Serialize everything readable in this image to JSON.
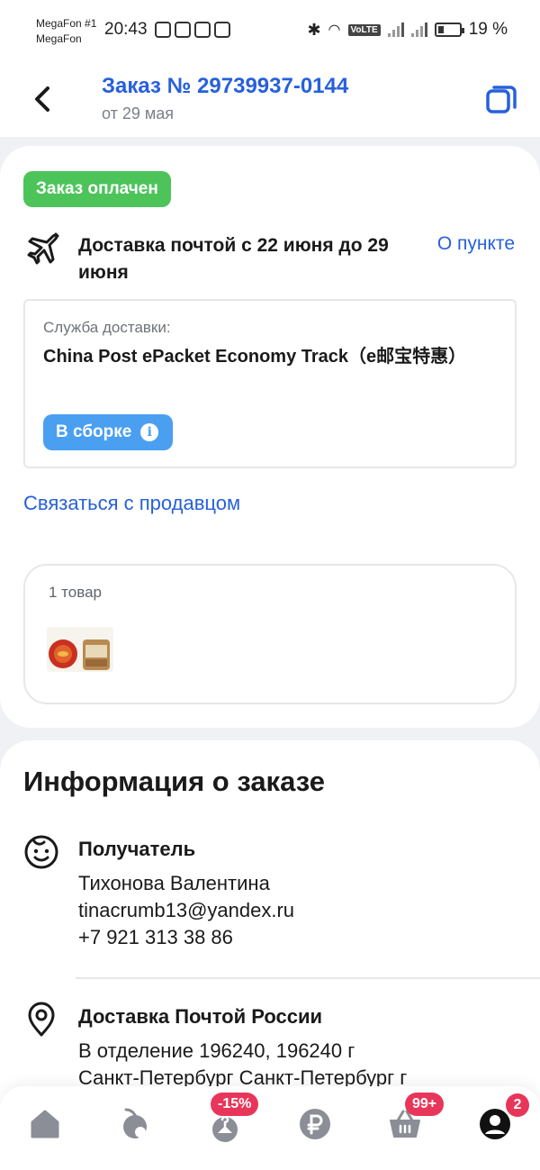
{
  "status_bar": {
    "carrier_line1": "MegaFon #1",
    "carrier_line2": "MegaFon",
    "time": "20:43",
    "volte": "VoLTE",
    "battery": "19 %"
  },
  "header": {
    "title": "Заказ № 29739937-0144",
    "date": "от 29 мая"
  },
  "order": {
    "status_badge": "Заказ оплачен",
    "delivery_text": "Доставка почтой с 22 июня до 29 июня",
    "point_link": "О пункте",
    "service_label": "Служба доставки:",
    "service_name": "China Post ePacket Economy Track（e邮宝特惠）",
    "assembly_status": "В сборке",
    "contact_seller": "Связаться с продавцом",
    "items_count": "1 товар"
  },
  "info": {
    "heading": "Информация о заказе",
    "recipient_title": "Получатель",
    "recipient_name": "Тихонова Валентина",
    "recipient_email": "tinacrumb13@yandex.ru",
    "recipient_phone": "+7 921 313 38 86",
    "delivery_title": "Доставка Почтой России",
    "delivery_line1": "В отделение 196240, 196240 г",
    "delivery_line2": "Санкт-Петербург Санкт-Петербург г"
  },
  "bottom_nav": {
    "items": [
      {
        "icon": "home-icon"
      },
      {
        "icon": "catalog-icon"
      },
      {
        "icon": "hanger-icon",
        "badge": "-15%"
      },
      {
        "icon": "ruble-icon"
      },
      {
        "icon": "basket-icon",
        "badge": "99+"
      },
      {
        "icon": "profile-icon",
        "badge": "2"
      }
    ]
  },
  "colors": {
    "accent_blue": "#2760dc",
    "paid_green": "#4cc45a",
    "status_blue": "#4a9ff0",
    "badge_red": "#e8365a"
  }
}
